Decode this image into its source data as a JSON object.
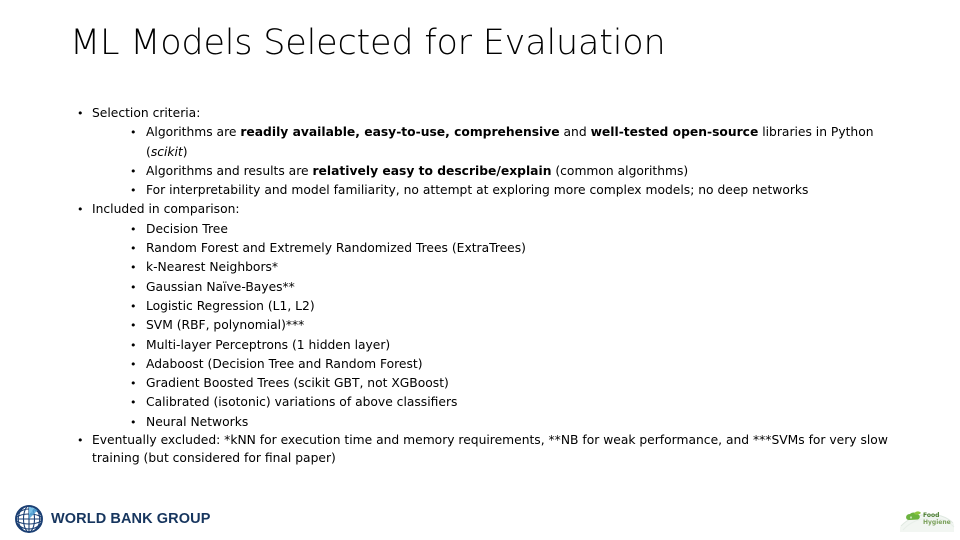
{
  "slide": {
    "title": "ML Models Selected for Evaluation",
    "groups": [
      {
        "id": "criteria",
        "heading": "Selection criteria:",
        "items": [
          {
            "segments": [
              {
                "text": "Algorithms are ",
                "style": "normal"
              },
              {
                "text": "readily available, easy-to-use, comprehensive",
                "style": "bold"
              },
              {
                "text": " and ",
                "style": "normal"
              },
              {
                "text": "well-tested open-source",
                "style": "bold"
              },
              {
                "text": " libraries in Python (",
                "style": "normal"
              },
              {
                "text": "scikit",
                "style": "italic"
              },
              {
                "text": ")",
                "style": "normal"
              }
            ]
          },
          {
            "segments": [
              {
                "text": "Algorithms and results are ",
                "style": "normal"
              },
              {
                "text": "relatively easy to describe/explain",
                "style": "bold"
              },
              {
                "text": " (common algorithms)",
                "style": "normal"
              }
            ]
          },
          {
            "segments": [
              {
                "text": "For interpretability and model familiarity, no attempt at exploring more complex models; no deep networks",
                "style": "normal"
              }
            ]
          }
        ]
      },
      {
        "id": "included",
        "heading": "Included in comparison:",
        "items": [
          {
            "segments": [
              {
                "text": "Decision Tree",
                "style": "normal"
              }
            ]
          },
          {
            "segments": [
              {
                "text": "Random Forest and Extremely Randomized Trees (ExtraTrees)",
                "style": "normal"
              }
            ]
          },
          {
            "segments": [
              {
                "text": "k-Nearest Neighbors*",
                "style": "normal"
              }
            ]
          },
          {
            "segments": [
              {
                "text": "Gaussian Naïve-Bayes**",
                "style": "normal"
              }
            ]
          },
          {
            "segments": [
              {
                "text": "Logistic Regression (L1, L2)",
                "style": "normal"
              }
            ]
          },
          {
            "segments": [
              {
                "text": "SVM (RBF, polynomial)***",
                "style": "normal"
              }
            ]
          },
          {
            "segments": [
              {
                "text": "Multi-layer Perceptrons (1 hidden layer)",
                "style": "normal"
              }
            ]
          },
          {
            "segments": [
              {
                "text": "Adaboost (Decision Tree and Random Forest)",
                "style": "normal"
              }
            ]
          },
          {
            "segments": [
              {
                "text": "Gradient Boosted Trees (scikit GBT, not XGBoost)",
                "style": "normal"
              }
            ]
          },
          {
            "segments": [
              {
                "text": "Calibrated (isotonic) variations of above classifiers",
                "style": "normal"
              }
            ]
          },
          {
            "segments": [
              {
                "text": "Neural Networks",
                "style": "normal"
              }
            ]
          }
        ]
      },
      {
        "id": "excluded",
        "heading": "Eventually excluded: *kNN for execution time and memory requirements, **NB for weak performance, and ***SVMs for very slow training (but considered for final paper)",
        "items": []
      }
    ]
  },
  "logos": {
    "world_bank": {
      "name": "world-bank-group-logo",
      "text": "WORLD BANK GROUP",
      "globe_color": "#1b3f73",
      "globe_highlight": "#4a9fd4",
      "text_color": "#16355e"
    },
    "aux": {
      "name": "food-hygiene-logo",
      "line1": "Food",
      "line2": "Hygiene",
      "leaf_color": "#6cb33f",
      "text_color": "#4a7c2f"
    }
  }
}
